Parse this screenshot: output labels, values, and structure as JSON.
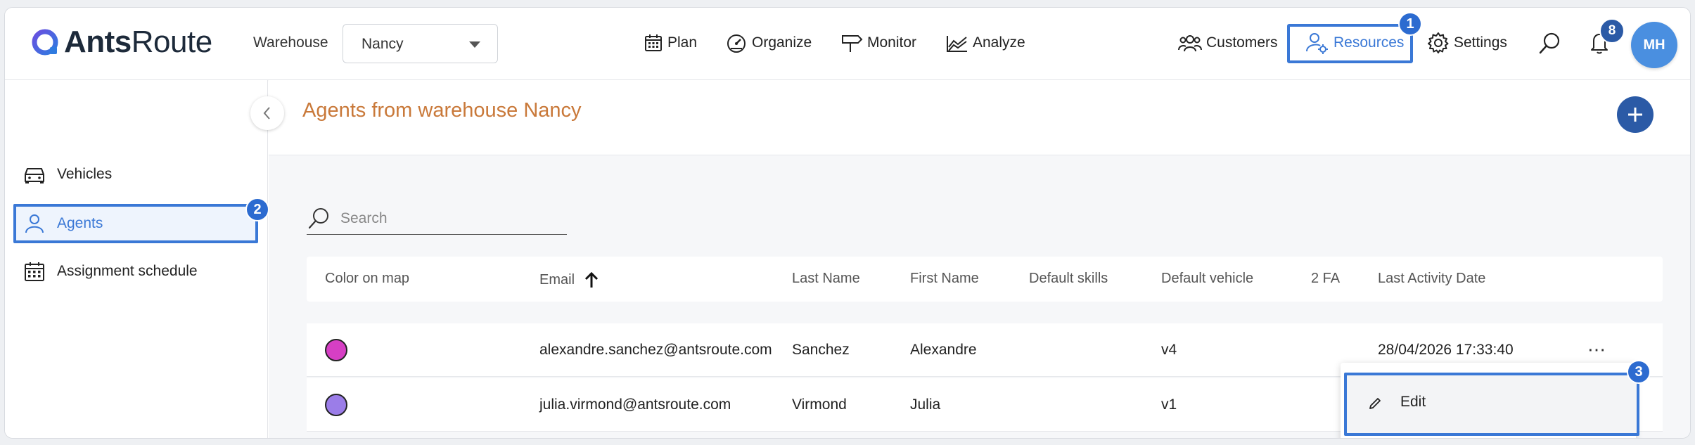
{
  "brand": {
    "name_bold": "Ants",
    "name_light": "Route"
  },
  "warehouse": {
    "label": "Warehouse",
    "selected": "Nancy"
  },
  "nav": {
    "plan": "Plan",
    "organize": "Organize",
    "monitor": "Monitor",
    "analyze": "Analyze",
    "customers": "Customers",
    "resources": "Resources",
    "settings": "Settings"
  },
  "user": {
    "initials": "MH",
    "notifications": "8"
  },
  "steps": {
    "one": "1",
    "two": "2",
    "three": "3"
  },
  "sidebar": {
    "items": [
      {
        "label": "Vehicles"
      },
      {
        "label": "Agents"
      },
      {
        "label": "Assignment schedule"
      }
    ]
  },
  "main": {
    "title": "Agents from warehouse Nancy",
    "search_placeholder": "Search"
  },
  "table": {
    "columns": [
      "Color on map",
      "Email",
      "Last Name",
      "First Name",
      "Default skills",
      "Default vehicle",
      "2 FA",
      "Last Activity Date"
    ],
    "rows": [
      {
        "color": "#d63fc4",
        "email": "alexandre.sanchez@antsroute.com",
        "last_name": "Sanchez",
        "first_name": "Alexandre",
        "skills": "",
        "vehicle": "v4",
        "twofa": "",
        "last_activity": "28/04/2026 17:33:40"
      },
      {
        "color": "#9b7de8",
        "email": "julia.virmond@antsroute.com",
        "last_name": "Virmond",
        "first_name": "Julia",
        "skills": "",
        "vehicle": "v1",
        "twofa": "",
        "last_activity": ""
      }
    ]
  },
  "context_menu": {
    "edit": "Edit"
  },
  "colors": {
    "accent": "#3a78d6",
    "primary_dark": "#2b5aa6",
    "title": "#c9793a"
  }
}
